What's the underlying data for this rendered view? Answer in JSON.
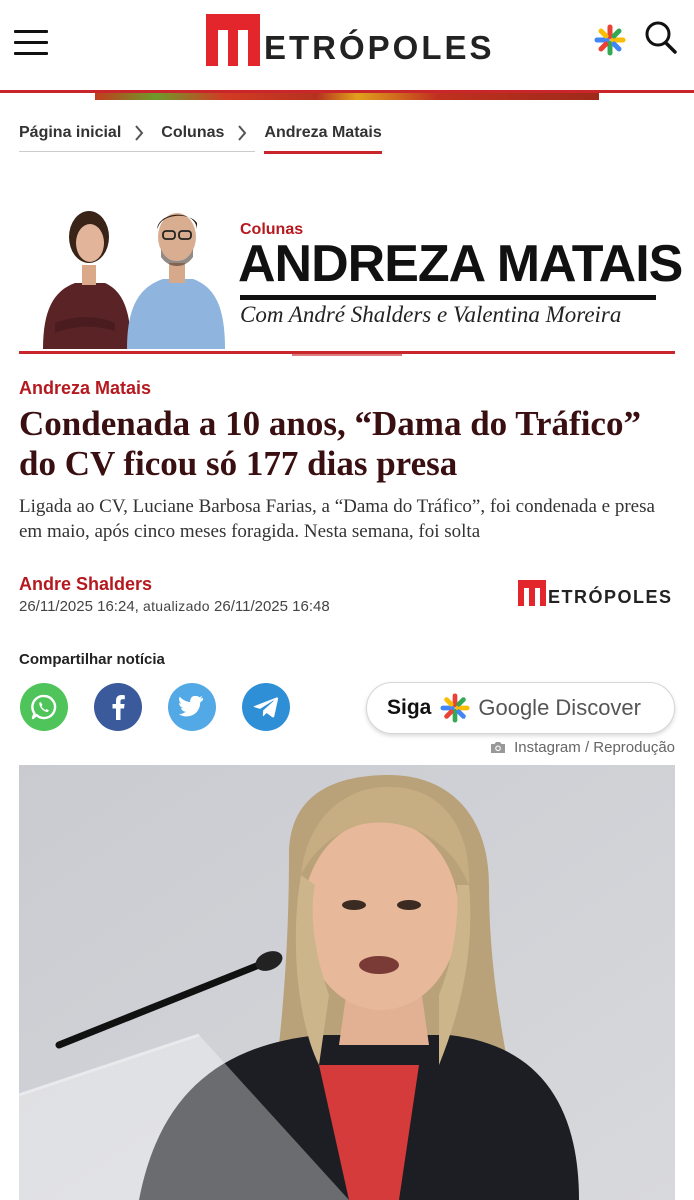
{
  "header": {
    "logo_text": "ETRÓPOLES",
    "menu_icon": "hamburger-menu-icon",
    "discover_icon": "google-discover-icon",
    "search_icon": "search-icon",
    "accent_color": "#c8262a"
  },
  "breadcrumb": {
    "items": [
      {
        "label": "Página inicial"
      },
      {
        "label": "Colunas"
      },
      {
        "label": "Andreza Matais"
      }
    ]
  },
  "column": {
    "label": "Colunas",
    "title": "ANDREZA MATAIS",
    "subtitle": "Com André Shalders e Valentina Moreira"
  },
  "article": {
    "kicker": "Andreza Matais",
    "headline": "Condenada a 10 anos, “Dama do Tráfico” do CV ficou só 177 dias presa",
    "summary": "Ligada ao CV, Luciane Barbosa Farias, a “Dama do Tráfico”, foi condenada e presa em maio, após cinco meses foragida. Nesta semana, foi solta",
    "author": "Andre Shalders",
    "published": "26/11/2025 16:24,",
    "updated_label": "atualizado",
    "updated": "26/11/2025 16:48",
    "source_logo_text": "ETRÓPOLES"
  },
  "share": {
    "label": "Compartilhar notícia",
    "buttons": [
      {
        "icon": "whatsapp-icon",
        "color": "#4fc45a"
      },
      {
        "icon": "facebook-icon",
        "color": "#3a5a9c"
      },
      {
        "icon": "twitter-icon",
        "color": "#52a9e6"
      },
      {
        "icon": "telegram-icon",
        "color": "#2e8fd6"
      }
    ],
    "follow": {
      "siga": "Siga",
      "text": "Google Discover"
    }
  },
  "photo": {
    "credit": "Instagram / Reprodução"
  }
}
